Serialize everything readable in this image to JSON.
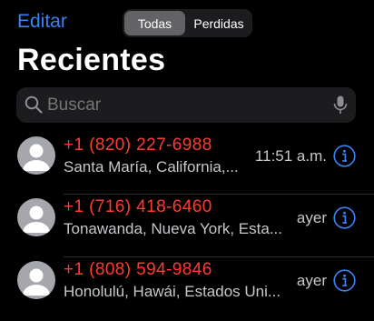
{
  "header": {
    "edit_label": "Editar",
    "segment": {
      "options": [
        "Todas",
        "Perdidas"
      ],
      "selected": "Todas"
    },
    "title": "Recientes"
  },
  "search": {
    "placeholder": "Buscar",
    "icon": "search-icon",
    "mic_icon": "microphone-icon"
  },
  "calls": [
    {
      "number": "+1 (820) 227-6988",
      "location": "Santa María, California,...",
      "time": "11:51 a.m."
    },
    {
      "number": "+1 (716) 418-6460",
      "location": "Tonawanda, Nueva York, Esta...",
      "time": "ayer"
    },
    {
      "number": "+1 (808) 594-9846",
      "location": "Honolulú, Hawái, Estados Uni...",
      "time": "ayer"
    }
  ],
  "colors": {
    "accent": "#3b82f6",
    "missed_call": "#ff3b30",
    "background": "#000000"
  }
}
